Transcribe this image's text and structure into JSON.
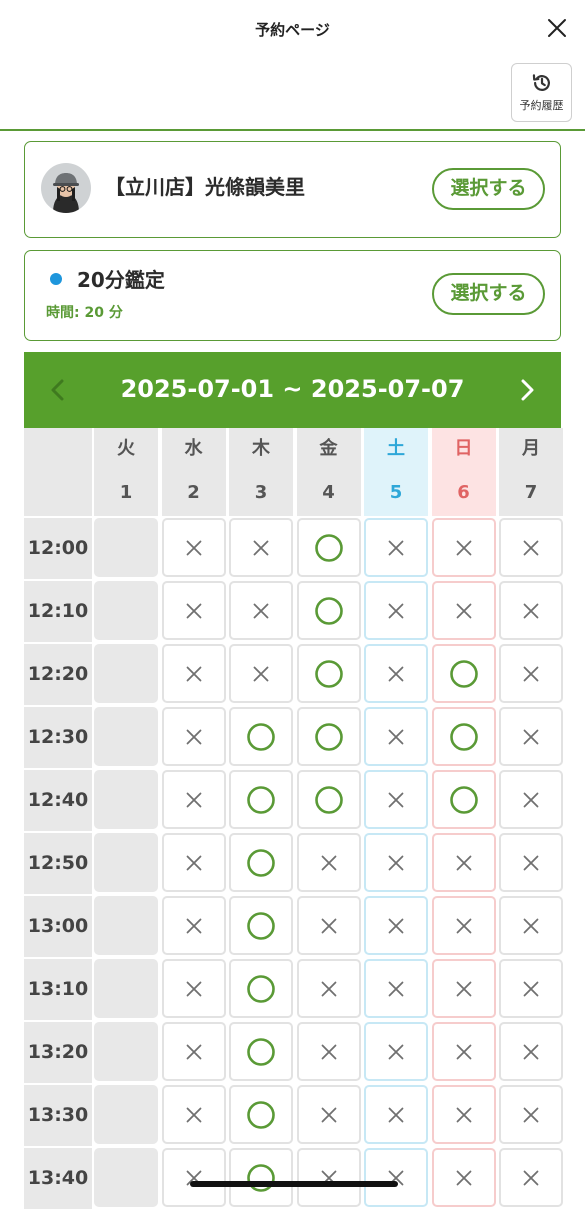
{
  "header": {
    "title": "予約ページ",
    "close_icon": "close-icon",
    "history_label": "予約履歴",
    "history_icon": "history-icon"
  },
  "staff": {
    "name": "【立川店】光條韻美里",
    "select_label": "選択する",
    "avatar_icon": "avatar"
  },
  "menu": {
    "name": "20分鑑定",
    "time_label": "時間: 20 分",
    "select_label": "選択する",
    "dot_color": "#1e96dc"
  },
  "calendar": {
    "range": "2025-07-01 ~ 2025-07-07",
    "prev_icon": "chevron-left-icon",
    "next_icon": "chevron-right-icon",
    "days": [
      {
        "dow": "火",
        "date": "1",
        "type": "weekday"
      },
      {
        "dow": "水",
        "date": "2",
        "type": "weekday"
      },
      {
        "dow": "木",
        "date": "3",
        "type": "weekday"
      },
      {
        "dow": "金",
        "date": "4",
        "type": "weekday"
      },
      {
        "dow": "土",
        "date": "5",
        "type": "sat"
      },
      {
        "dow": "日",
        "date": "6",
        "type": "sun"
      },
      {
        "dow": "月",
        "date": "7",
        "type": "weekday"
      }
    ],
    "slots": [
      {
        "time": "12:00",
        "status": [
          "-",
          "x",
          "x",
          "o",
          "x",
          "x",
          "x"
        ]
      },
      {
        "time": "12:10",
        "status": [
          "-",
          "x",
          "x",
          "o",
          "x",
          "x",
          "x"
        ]
      },
      {
        "time": "12:20",
        "status": [
          "-",
          "x",
          "x",
          "o",
          "x",
          "o",
          "x"
        ]
      },
      {
        "time": "12:30",
        "status": [
          "-",
          "x",
          "o",
          "o",
          "x",
          "o",
          "x"
        ]
      },
      {
        "time": "12:40",
        "status": [
          "-",
          "x",
          "o",
          "o",
          "x",
          "o",
          "x"
        ]
      },
      {
        "time": "12:50",
        "status": [
          "-",
          "x",
          "o",
          "x",
          "x",
          "x",
          "x"
        ]
      },
      {
        "time": "13:00",
        "status": [
          "-",
          "x",
          "o",
          "x",
          "x",
          "x",
          "x"
        ]
      },
      {
        "time": "13:10",
        "status": [
          "-",
          "x",
          "o",
          "x",
          "x",
          "x",
          "x"
        ]
      },
      {
        "time": "13:20",
        "status": [
          "-",
          "x",
          "o",
          "x",
          "x",
          "x",
          "x"
        ]
      },
      {
        "time": "13:30",
        "status": [
          "-",
          "x",
          "o",
          "x",
          "x",
          "x",
          "x"
        ]
      },
      {
        "time": "13:40",
        "status": [
          "-",
          "x",
          "o",
          "x",
          "x",
          "x",
          "x"
        ]
      }
    ],
    "colors": {
      "available": "#5a9a36",
      "unavailable": "#707070",
      "accent": "#57a02c"
    }
  }
}
